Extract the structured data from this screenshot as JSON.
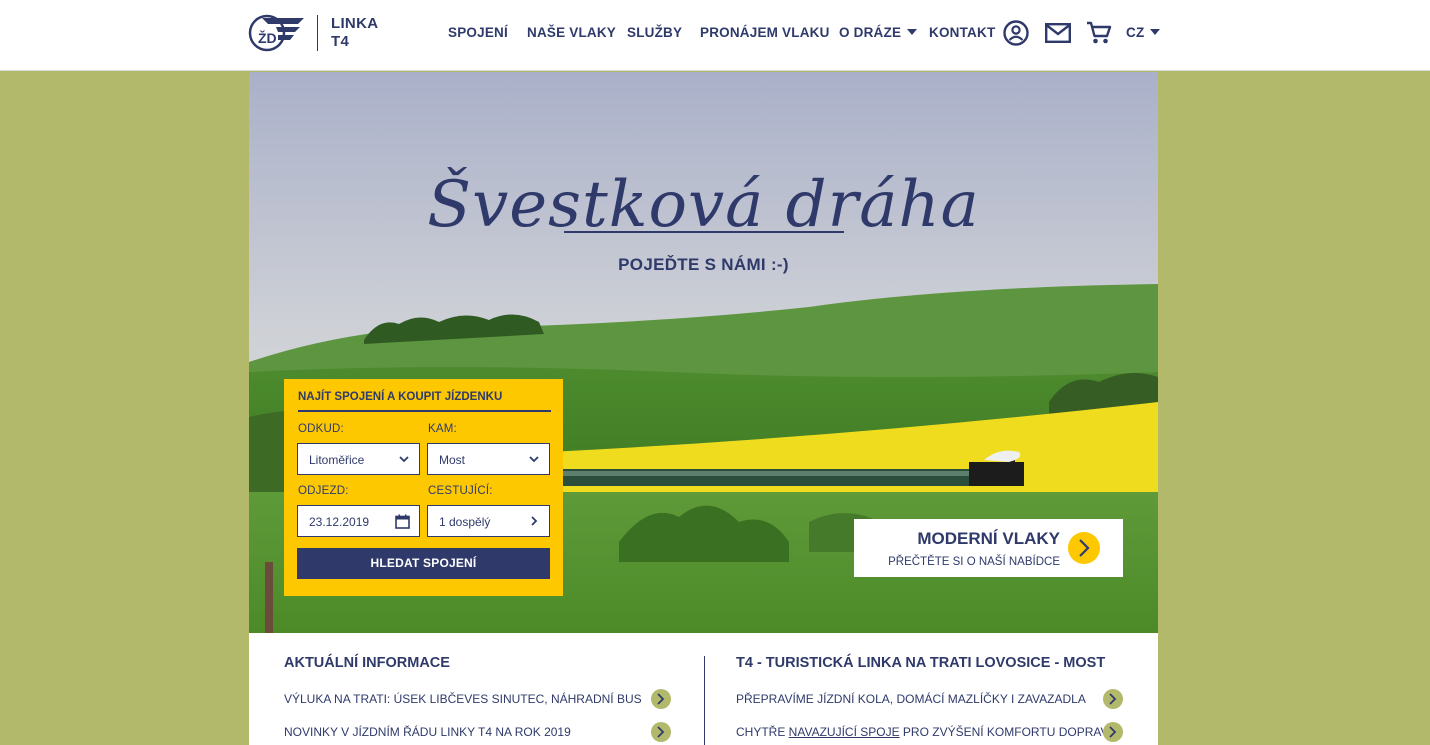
{
  "brand": {
    "line1": "LINKA",
    "line2": "T4",
    "logo_letters": "ŽD"
  },
  "nav": {
    "spojeni": "SPOJENÍ",
    "nase_vlaky": "NAŠE VLAKY",
    "sluzby": "SLUŽBY",
    "pronajem": "PRONÁJEM VLAKU",
    "o_draze": "O DRÁZE",
    "kontakt": "KONTAKT",
    "lang": "CZ"
  },
  "hero": {
    "title": "Švestková dráha",
    "subtitle": "POJEĎTE S NÁMI :-)"
  },
  "booking": {
    "title": "NAJÍT SPOJENÍ A KOUPIT JÍZDENKU",
    "from_label": "ODKUD:",
    "from_value": "Litoměřice",
    "to_label": "KAM:",
    "to_value": "Most",
    "date_label": "ODJEZD:",
    "date_value": "23.12.2019",
    "passengers_label": "CESTUJÍCÍ:",
    "passengers_value": "1 dospělý",
    "search_button": "HLEDAT SPOJENÍ"
  },
  "promo": {
    "title": "MODERNÍ VLAKY",
    "subtitle": "PŘEČTĚTE SI O NAŠÍ NABÍDCE"
  },
  "news": {
    "title": "AKTUÁLNÍ INFORMACE",
    "items": [
      "VÝLUKA NA TRATI: ÚSEK LIBČEVES SINUTEC, NÁHRADNÍ BUS",
      "NOVINKY V JÍZDNÍM ŘÁDU LINKY T4 NA ROK 2019"
    ]
  },
  "line_info": {
    "title": "T4 - TURISTICKÁ LINKA NA TRATI LOVOSICE - MOST",
    "item1": "PŘEPRAVÍME JÍZDNÍ KOLA, DOMÁCÍ MAZLÍČKY I ZAVAZADLA",
    "item2_pre": "CHYTŘE ",
    "item2_link": "NAVAZUJÍCÍ SPOJE",
    "item2_post": " PRO ZVÝŠENÍ KOMFORTU DOPRAVY"
  },
  "colors": {
    "navy": "#2f3a6b",
    "yellow": "#fdc800",
    "olive": "#b3b96b"
  }
}
